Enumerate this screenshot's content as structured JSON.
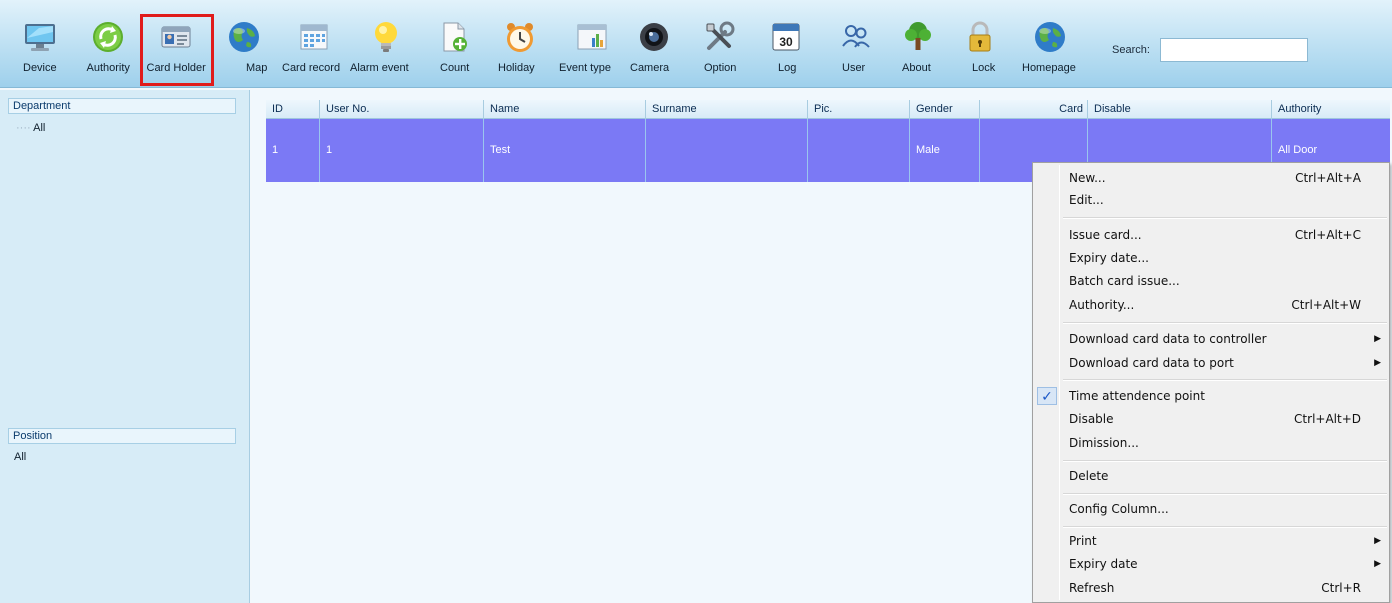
{
  "toolbar": {
    "items": [
      {
        "label": "Device",
        "icon": "monitor-icon"
      },
      {
        "label": "Authority",
        "icon": "green-refresh-icon"
      },
      {
        "label": "Card Holder",
        "icon": "id-card-icon"
      },
      {
        "label": "Map",
        "icon": "globe-icon"
      },
      {
        "label": "Card record",
        "icon": "calendar-grid-icon"
      },
      {
        "label": "Alarm event",
        "icon": "lightbulb-icon"
      },
      {
        "label": "Count",
        "icon": "document-plus-icon"
      },
      {
        "label": "Holiday",
        "icon": "alarm-clock-icon"
      },
      {
        "label": "Event type",
        "icon": "window-chart-icon"
      },
      {
        "label": "Camera",
        "icon": "camera-lens-icon"
      },
      {
        "label": "Option",
        "icon": "tools-icon"
      },
      {
        "label": "Log",
        "icon": "calendar-30-icon"
      },
      {
        "label": "User",
        "icon": "users-icon"
      },
      {
        "label": "About",
        "icon": "tree-icon"
      },
      {
        "label": "Lock",
        "icon": "padlock-icon"
      },
      {
        "label": "Homepage",
        "icon": "globe-icon"
      }
    ],
    "log_day": "30",
    "search_label": "Search:",
    "search_value": "",
    "highlight_color": "#e01b1b"
  },
  "left": {
    "department_title": "Department",
    "department_items": [
      "All"
    ],
    "position_title": "Position",
    "position_items": [
      "All"
    ]
  },
  "grid": {
    "columns": [
      "ID",
      "User No.",
      "Name",
      "Surname",
      "Pic.",
      "Gender",
      "Card",
      "Disable",
      "Authority"
    ],
    "rows": [
      [
        "1",
        "1",
        "Test",
        "",
        "",
        "Male",
        "",
        "",
        "All Door"
      ]
    ],
    "selected_row_color": "#7b79f5"
  },
  "context_menu": {
    "items": [
      {
        "label": "New...",
        "shortcut": "Ctrl+Alt+A"
      },
      {
        "label": "Edit...",
        "shortcut": ""
      },
      {
        "label": "Issue card...",
        "shortcut": "Ctrl+Alt+C"
      },
      {
        "label": "Expiry date...",
        "shortcut": ""
      },
      {
        "label": "Batch card issue...",
        "shortcut": ""
      },
      {
        "label": "Authority...",
        "shortcut": "Ctrl+Alt+W"
      },
      {
        "label": "Download card data to controller",
        "submenu": true
      },
      {
        "label": "Download card data to port",
        "submenu": true
      },
      {
        "label": "Time attendence point",
        "checked": true
      },
      {
        "label": "Disable",
        "shortcut": "Ctrl+Alt+D"
      },
      {
        "label": "Dimission...",
        "shortcut": ""
      },
      {
        "label": "Delete",
        "shortcut": ""
      },
      {
        "label": "Config Column...",
        "shortcut": ""
      },
      {
        "label": "Print",
        "submenu": true
      },
      {
        "label": "Expiry date",
        "submenu": true
      },
      {
        "label": "Refresh",
        "shortcut": "Ctrl+R"
      }
    ]
  }
}
